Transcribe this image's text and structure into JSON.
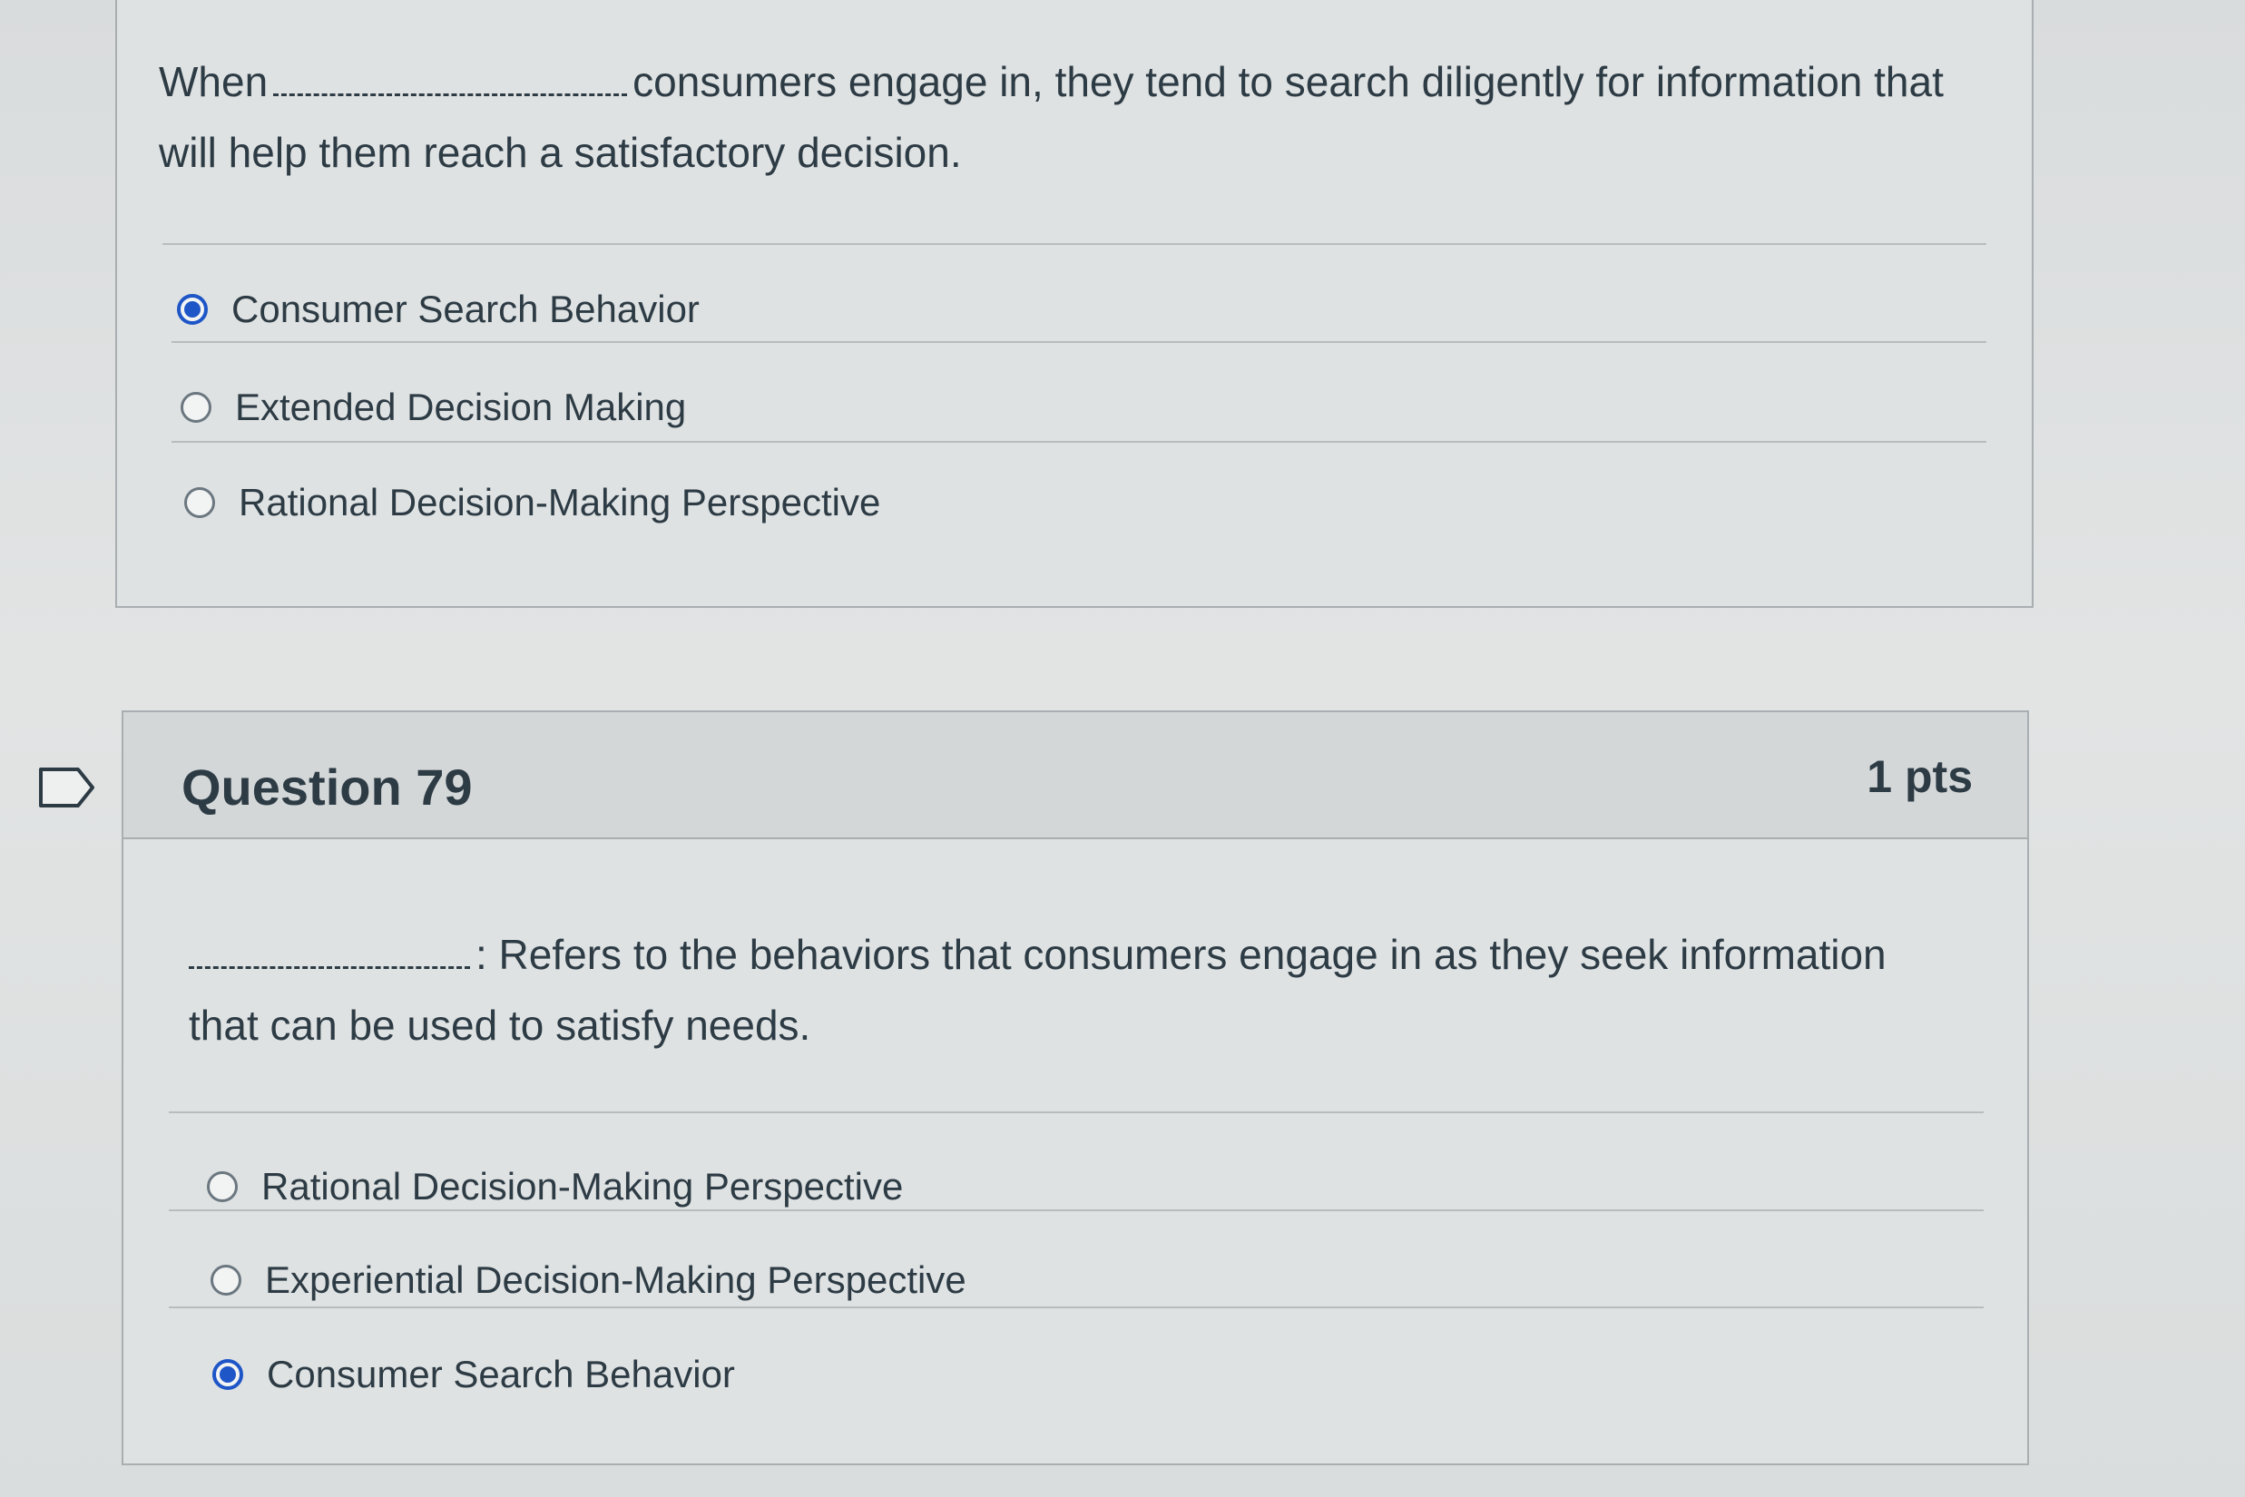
{
  "question_prev": {
    "text_before_blank": "When",
    "text_after_blank": "consumers engage in, they tend to search diligently for information that will help them reach a satisfactory decision.",
    "answers": [
      {
        "label": "Consumer Search Behavior",
        "selected": true
      },
      {
        "label": "Extended Decision Making",
        "selected": false
      },
      {
        "label": "Rational Decision-Making Perspective",
        "selected": false
      }
    ]
  },
  "question_79": {
    "title": "Question 79",
    "points": "1 pts",
    "text_after_blank": ": Refers to the behaviors that consumers engage in as they seek information that can be used to satisfy needs.",
    "answers": [
      {
        "label": "Rational Decision-Making Perspective",
        "selected": false
      },
      {
        "label": "Experiential Decision-Making Perspective",
        "selected": false
      },
      {
        "label": "Consumer Search Behavior",
        "selected": true
      }
    ]
  },
  "colors": {
    "selected_radio": "#1e56c8",
    "text": "#2d3b45",
    "border": "#a9aeb1"
  }
}
